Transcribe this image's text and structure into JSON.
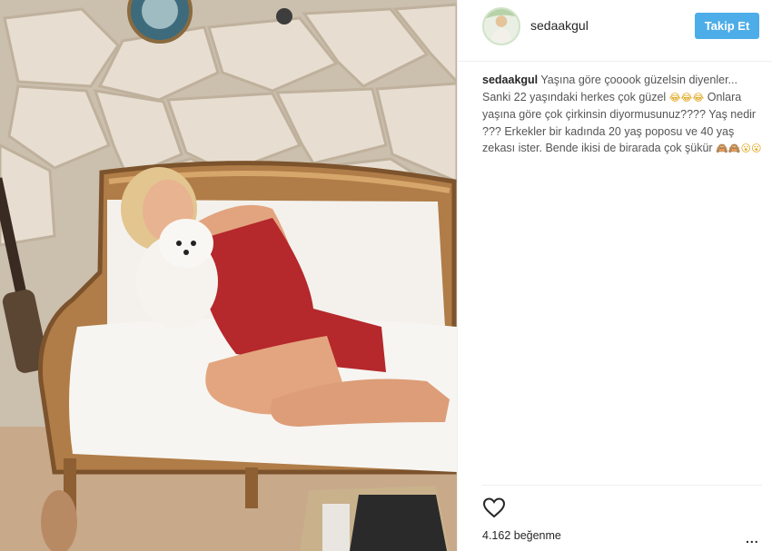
{
  "post": {
    "username": "sedaakgul",
    "follow_label": "Takip Et",
    "caption_user": "sedaakgul",
    "caption_part1": "Yaşına göre çooook güzelsin diyenler... Sanki 22 yaşındaki herkes çok güzel",
    "caption_emoji1": "😂😂😂",
    "caption_part2": "Onlara yaşına göre çok çirkinsin diyormusunuz???? Yaş nedir ??? Erkekler bir kadında 20 yaş poposu ve 40 yaş zekası ister. Bende ikisi de birarada çok şükür",
    "caption_emoji2": "🙈🙈😮😮",
    "likes_text": "4.162 beğenme",
    "more_label": "..."
  },
  "icons": {
    "like": "heart-icon",
    "more": "more-options-icon",
    "avatar": "profile-avatar"
  },
  "colors": {
    "follow_button": "#4dade8",
    "dress": "#b5282b",
    "text": "#262626"
  }
}
